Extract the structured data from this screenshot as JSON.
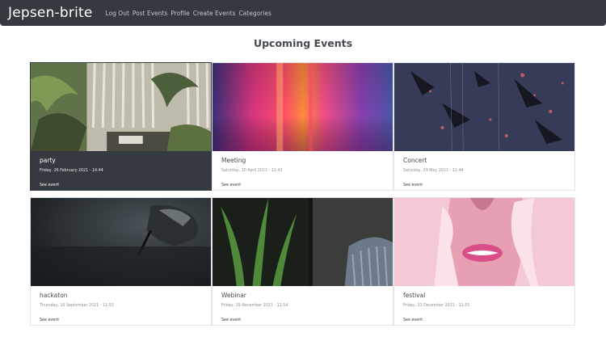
{
  "brand": "Jepsen-brite",
  "nav": [
    "Log Out",
    "Post Events",
    "Profile",
    "Create Events",
    "Categories"
  ],
  "page_title": "Upcoming Events",
  "events": [
    {
      "title": "party",
      "date": "Friday, 26 February 2021 - 14:44",
      "link": "See event"
    },
    {
      "title": "Meeting",
      "date": "Saturday, 10 April 2021 - 11:43",
      "link": "See event"
    },
    {
      "title": "Concert",
      "date": "Saturday, 29 May 2021 - 11:44",
      "link": "See event"
    },
    {
      "title": "hackaton",
      "date": "Thursday, 16 September 2021 - 11:53",
      "link": "See event"
    },
    {
      "title": "Webinar",
      "date": "Friday, 19 November 2021 - 11:54",
      "link": "See event"
    },
    {
      "title": "festival",
      "date": "Friday, 31 December 2021 - 11:55",
      "link": "See event"
    }
  ],
  "colors": {
    "navbar": "#343a40",
    "accent_card": "#343a40"
  }
}
